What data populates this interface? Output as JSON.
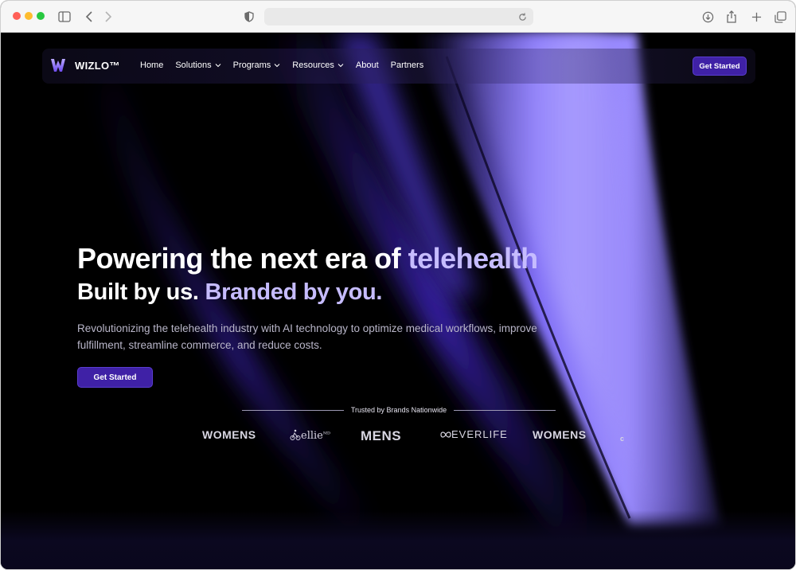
{
  "browser": {
    "url": "",
    "icons": [
      "sidebar-icon",
      "back-icon",
      "forward-icon",
      "shield-icon",
      "reload-icon",
      "download-icon",
      "share-icon",
      "new-tab-icon",
      "tabs-icon"
    ]
  },
  "nav": {
    "brand": "WIZLO™",
    "items": [
      {
        "label": "Home",
        "dropdown": false
      },
      {
        "label": "Solutions",
        "dropdown": true
      },
      {
        "label": "Programs",
        "dropdown": true
      },
      {
        "label": "Resources",
        "dropdown": true
      },
      {
        "label": "About",
        "dropdown": false
      },
      {
        "label": "Partners",
        "dropdown": false
      }
    ],
    "cta": "Get Started"
  },
  "hero": {
    "title_main": "Powering the next era of ",
    "title_accent": "telehealth",
    "sub_main": "Built by us. ",
    "sub_accent": "Branded by you.",
    "description": "Revolutionizing the telehealth industry with AI technology to optimize medical workflows, improve fulfillment, streamline commerce, and reduce costs.",
    "cta": "Get Started"
  },
  "trusted": {
    "label": "Trusted by Brands Nationwide",
    "brands": [
      "WOMENS",
      "ellie",
      "MENS",
      "EVERLIFE",
      "WOMENS"
    ]
  },
  "colors": {
    "accent": "#3f21a6",
    "accent_text": "#c6bcff",
    "background": "#000000"
  }
}
